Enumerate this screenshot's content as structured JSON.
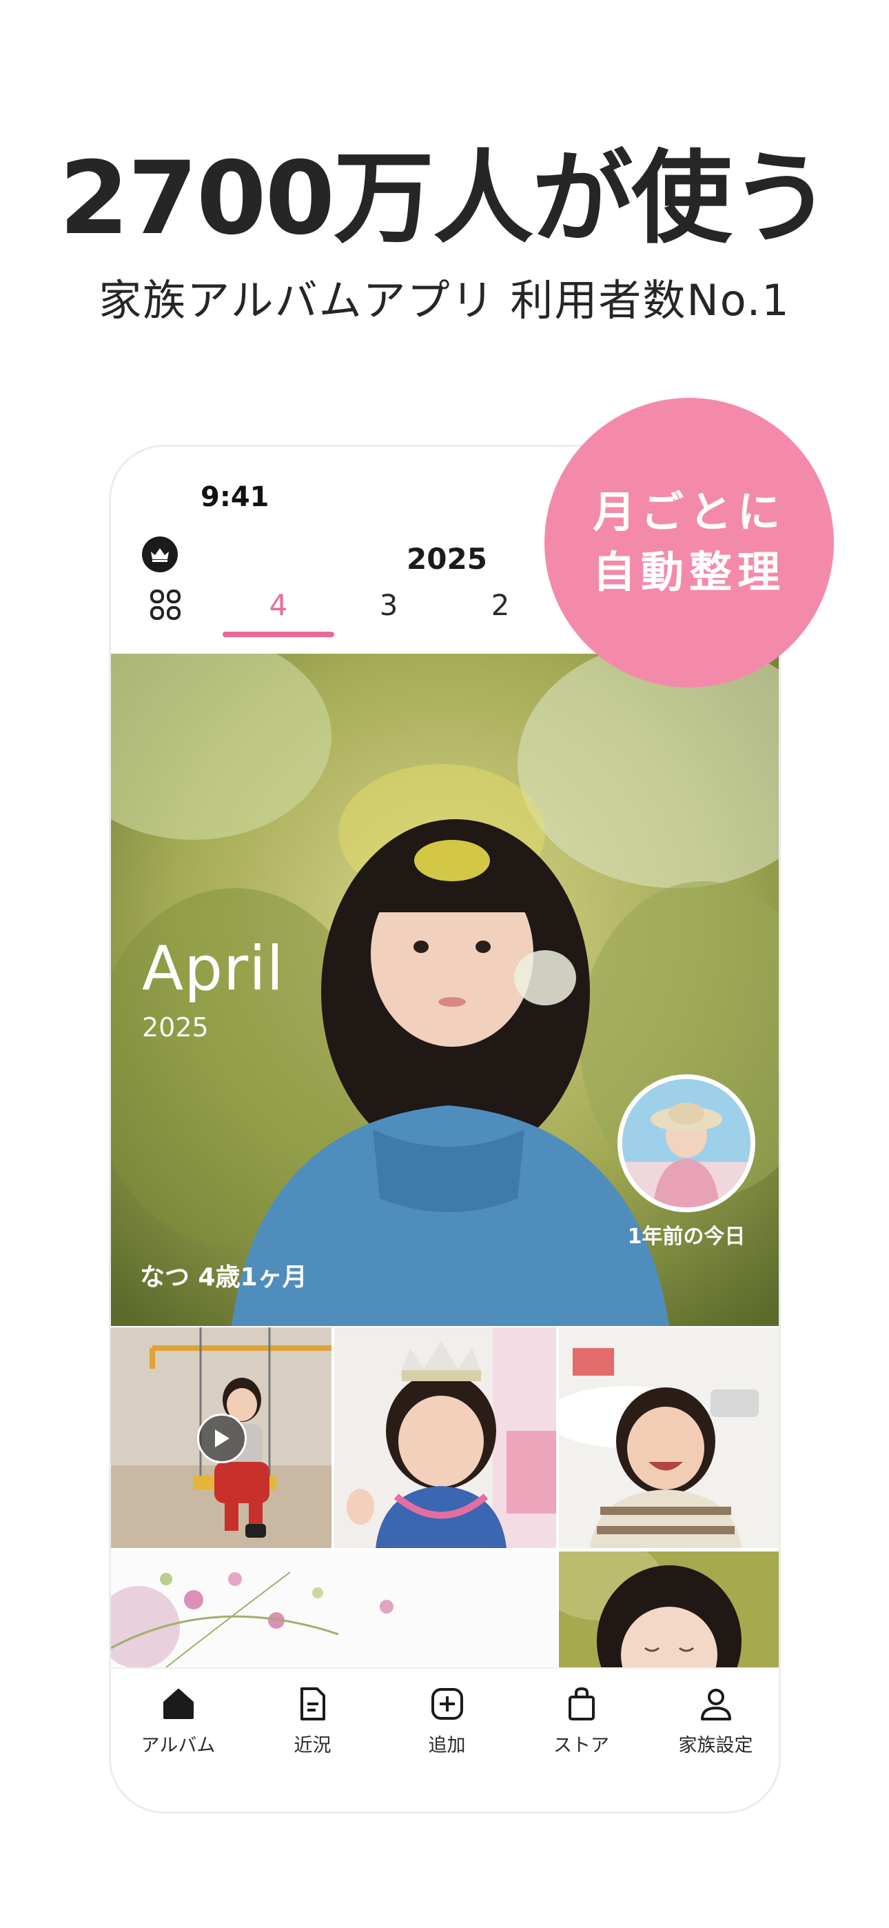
{
  "promo": {
    "headline": "2700万人が使う",
    "subheadline": "家族アルバムアプリ 利用者数No.1",
    "badge_line1": "月ごとに",
    "badge_line2": "自動整理"
  },
  "status_bar": {
    "time": "9:41"
  },
  "header": {
    "year": "2025",
    "month_tabs": [
      "4",
      "3",
      "2"
    ],
    "active_tab": "4"
  },
  "hero": {
    "month": "April",
    "year": "2025",
    "caption": "なつ 4歳1ヶ月",
    "memory_label": "1年前の今日"
  },
  "tab_bar": {
    "items": [
      {
        "label": "アルバム",
        "icon": "home-icon"
      },
      {
        "label": "近況",
        "icon": "document-icon"
      },
      {
        "label": "追加",
        "icon": "add-icon"
      },
      {
        "label": "ストア",
        "icon": "bag-icon"
      },
      {
        "label": "家族設定",
        "icon": "person-icon"
      }
    ]
  },
  "colors": {
    "accent_pink": "#e96a98",
    "badge_pink": "#f48aaa",
    "text_dark": "#262626"
  }
}
